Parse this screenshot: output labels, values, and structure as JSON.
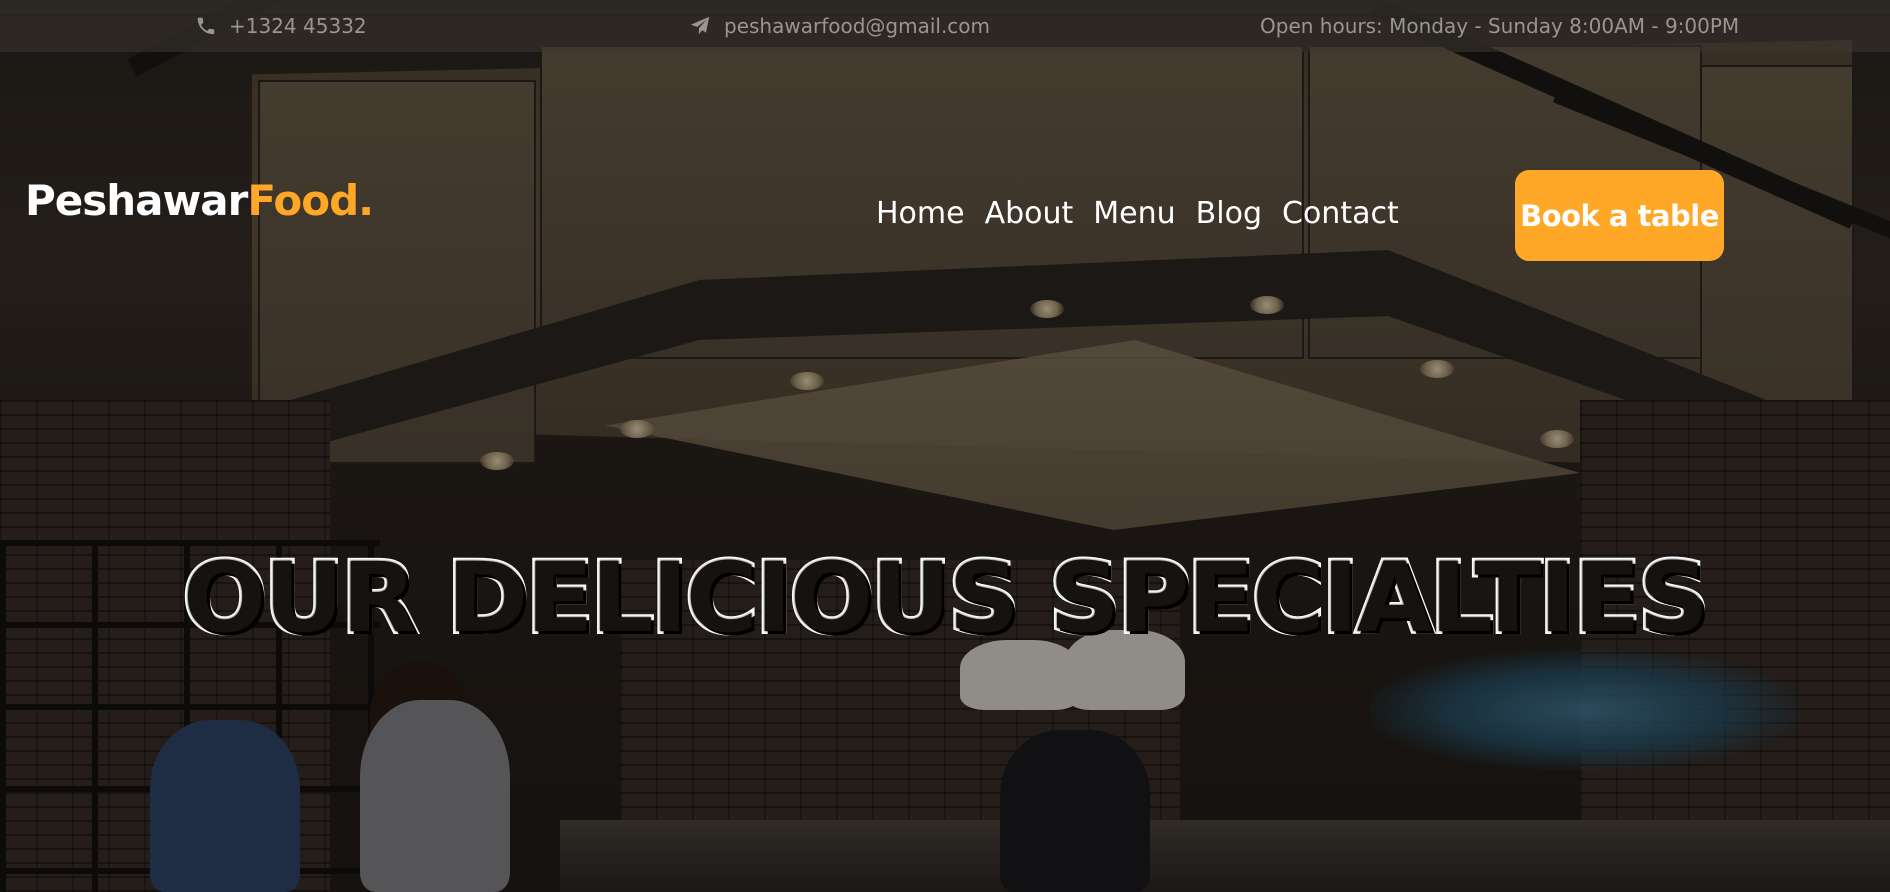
{
  "topbar": {
    "phone": "+1324 45332",
    "email": "peshawarfood@gmail.com",
    "hours": "Open hours: Monday - Sunday 8:00AM - 9:00PM",
    "icons": {
      "phone": "phone-icon",
      "email": "paper-plane-icon"
    }
  },
  "header": {
    "logo": {
      "primary": "Peshawar",
      "accent": "Food."
    },
    "nav": [
      {
        "label": "Home"
      },
      {
        "label": "About"
      },
      {
        "label": "Menu"
      },
      {
        "label": "Blog"
      },
      {
        "label": "Contact"
      }
    ],
    "cta_label": "Book a table"
  },
  "hero": {
    "title": "OUR DELICIOUS SPECIALTIES"
  },
  "colors": {
    "accent": "#ffa726",
    "text_light": "#ffffff",
    "topbar_text": "#9a958e"
  }
}
